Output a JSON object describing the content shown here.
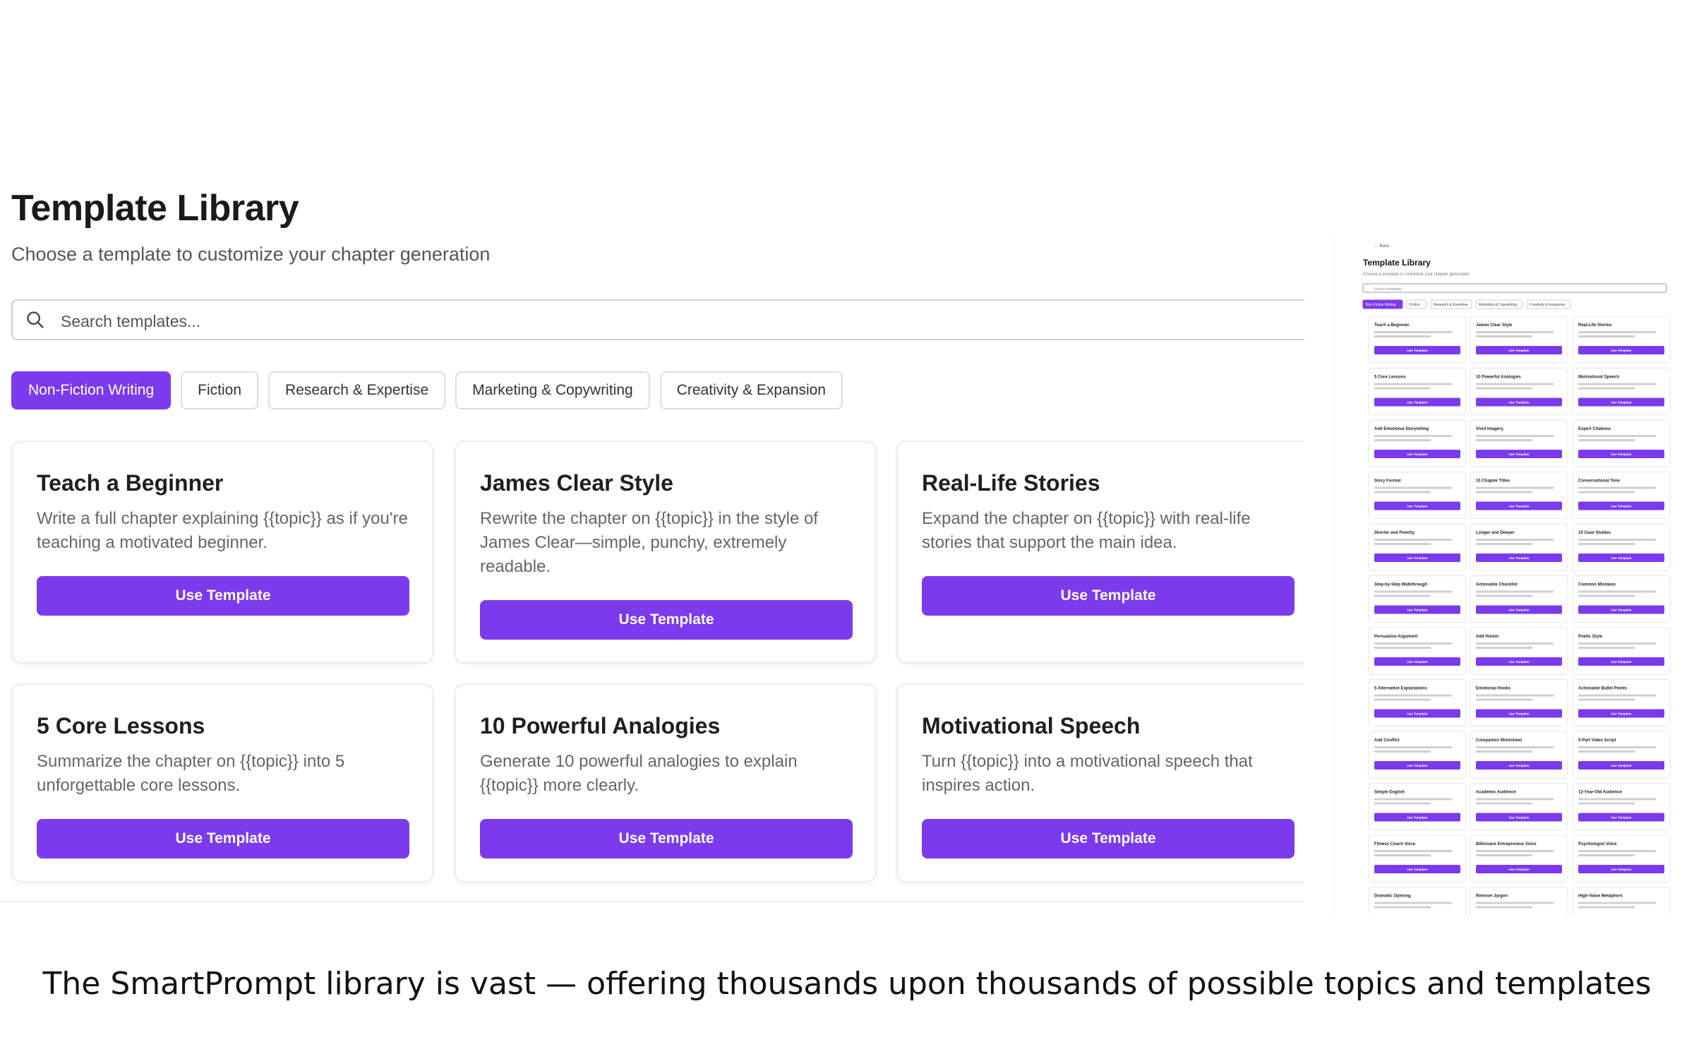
{
  "page": {
    "title": "Template Library",
    "subtitle": "Choose a template to customize your chapter generation",
    "search_placeholder": "Search templates..."
  },
  "tabs": [
    {
      "label": "Non-Fiction Writing",
      "active": true
    },
    {
      "label": "Fiction",
      "active": false
    },
    {
      "label": "Research & Expertise",
      "active": false
    },
    {
      "label": "Marketing & Copywriting",
      "active": false
    },
    {
      "label": "Creativity & Expansion",
      "active": false
    }
  ],
  "cards": [
    {
      "title": "Teach a Beginner",
      "description": "Write a full chapter explaining {{topic}} as if you're teaching a motivated beginner.",
      "button": "Use Template"
    },
    {
      "title": "James Clear Style",
      "description": "Rewrite the chapter on {{topic}} in the style of James Clear—simple, punchy, extremely readable.",
      "button": "Use Template"
    },
    {
      "title": "Real-Life Stories",
      "description": "Expand the chapter on {{topic}} with real-life stories that support the main idea.",
      "button": "Use Template"
    },
    {
      "title": "5 Core Lessons",
      "description": "Summarize the chapter on {{topic}} into 5 unforgettable core lessons.",
      "button": "Use Template"
    },
    {
      "title": "10 Powerful Analogies",
      "description": "Generate 10 powerful analogies to explain {{topic}} more clearly.",
      "button": "Use Template"
    },
    {
      "title": "Motivational Speech",
      "description": "Turn {{topic}} into a motivational speech that inspires action.",
      "button": "Use Template"
    }
  ],
  "thumbnail": {
    "back": "← Back",
    "title": "Template Library",
    "subtitle": "Choose a template to customize your chapter generation",
    "search_placeholder": "Search templates...",
    "tabs": [
      "Non-Fiction Writing",
      "Fiction",
      "Research & Expertise",
      "Marketing & Copywriting",
      "Creativity & Expansion"
    ],
    "cards": [
      "Teach a Beginner",
      "James Clear Style",
      "Real-Life Stories",
      "5 Core Lessons",
      "10 Powerful Analogies",
      "Motivational Speech",
      "Add Emotional Storytelling",
      "Vivid Imagery",
      "Expert Citations",
      "Story Format",
      "10 Chapter Titles",
      "Conversational Tone",
      "Shorter and Punchy",
      "Longer and Deeper",
      "10 Case Studies",
      "Step-by-Step Walkthrough",
      "Actionable Checklist",
      "Common Mistakes",
      "Persuasive Argument",
      "Add Humor",
      "Poetic Style",
      "5 Alternative Explanations",
      "Emotional Hooks",
      "Actionable Bullet Points",
      "Add Conflict",
      "Companion Worksheet",
      "5-Part Video Script",
      "Simple English",
      "Academic Audience",
      "12-Year-Old Audience",
      "Fitness Coach Voice",
      "Billionaire Entrepreneur Voice",
      "Psychologist Voice",
      "Dramatic Opening",
      "Remove Jargon",
      "High-Value Metaphors"
    ],
    "button": "Use Template"
  },
  "caption": "The SmartPrompt library is vast — offering thousands upon thousands of possible topics and templates",
  "colors": {
    "accent": "#7c3aed",
    "border": "#ececec",
    "muted_text": "#666666"
  }
}
